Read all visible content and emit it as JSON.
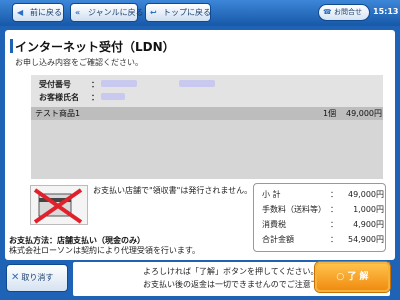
{
  "nav": {
    "back_label": "前に戻る",
    "genre_label": "ジャンルに戻る",
    "top_label": "トップに戻る",
    "inquiry_label": "お問合せ",
    "clock": "15:13"
  },
  "page": {
    "title": "インターネット受付（LDN）",
    "subtitle": "お申し込み内容をご確認ください。"
  },
  "info": {
    "receipt_no_label": "受付番号",
    "customer_name_label": "お客様氏名"
  },
  "items": [
    {
      "name": "テスト商品1",
      "qty": "1個",
      "price": "49,000円"
    }
  ],
  "receipt_note": "お支払い店舗で\"領収書\"は発行されません。",
  "summary": {
    "rows": [
      {
        "label": "小 計",
        "colon": "：",
        "value": "49,000円"
      },
      {
        "label": "手数料（送料等）",
        "colon": "：",
        "value": "1,000円"
      },
      {
        "label": "消費税",
        "colon": "：",
        "value": "4,900円"
      },
      {
        "label": "合計金額",
        "colon": "：",
        "value": "54,900円"
      }
    ]
  },
  "payment": {
    "method": "お支払方法：店舗支払い（現金のみ）",
    "note": "株式会社ローソンは契約により代理受領を行います。"
  },
  "bottom": {
    "cancel_label": "取り消す",
    "confirm_line1": "よろしければ「了解」ボタンを押してください。",
    "confirm_line2": "お支払い後の返金は一切できませんのでご注意下さい。",
    "ok_label": "了 解"
  }
}
